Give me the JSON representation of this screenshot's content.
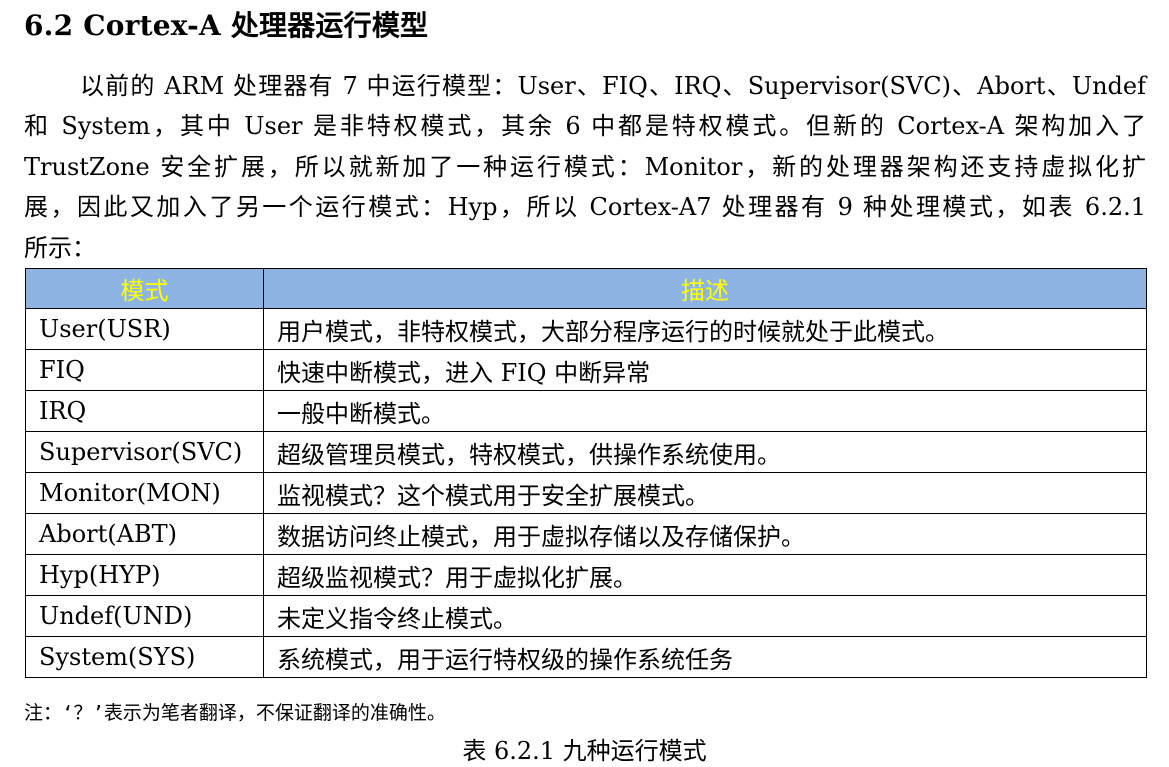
{
  "section": {
    "heading": "6.2 Cortex-A 处理器运行模型"
  },
  "paragraph": {
    "lines": [
      "以前的 ARM 处理器有 7 中运行模型：User、FIQ、IRQ、Supervisor(SVC)、Abort、Undef",
      "和 System，其中 User 是非特权模式，其余 6 中都是特权模式。但新的 Cortex-A 架构加入了",
      "TrustZone 安全扩展，所以就新加了一种运行模式：Monitor，新的处理器架构还支持虚拟化扩",
      "展，因此又加入了另一个运行模式：Hyp，所以 Cortex-A7 处理器有 9 种处理模式，如表 6.2.1",
      "所示："
    ]
  },
  "table": {
    "header_color": "#8db4e2",
    "header_text_color": "#ffff00",
    "headers": [
      "模式",
      "描述"
    ],
    "rows": [
      [
        "User(USR)",
        "用户模式，非特权模式，大部分程序运行的时候就处于此模式。"
      ],
      [
        "FIQ",
        "快速中断模式，进入 FIQ 中断异常"
      ],
      [
        "IRQ",
        "一般中断模式。"
      ],
      [
        "Supervisor(SVC)",
        "超级管理员模式，特权模式，供操作系统使用。"
      ],
      [
        "Monitor(MON)",
        "监视模式？这个模式用于安全扩展模式。"
      ],
      [
        "Abort(ABT)",
        "数据访问终止模式，用于虚拟存储以及存储保护。"
      ],
      [
        "Hyp(HYP)",
        "超级监视模式？用于虚拟化扩展。"
      ],
      [
        "Undef(UND)",
        "未定义指令终止模式。"
      ],
      [
        "System(SYS)",
        "系统模式，用于运行特权级的操作系统任务"
      ]
    ]
  },
  "note": "注：‘？’表示为笔者翻译，不保证翻译的准确性。",
  "caption": "表 6.2.1  九种运行模式"
}
